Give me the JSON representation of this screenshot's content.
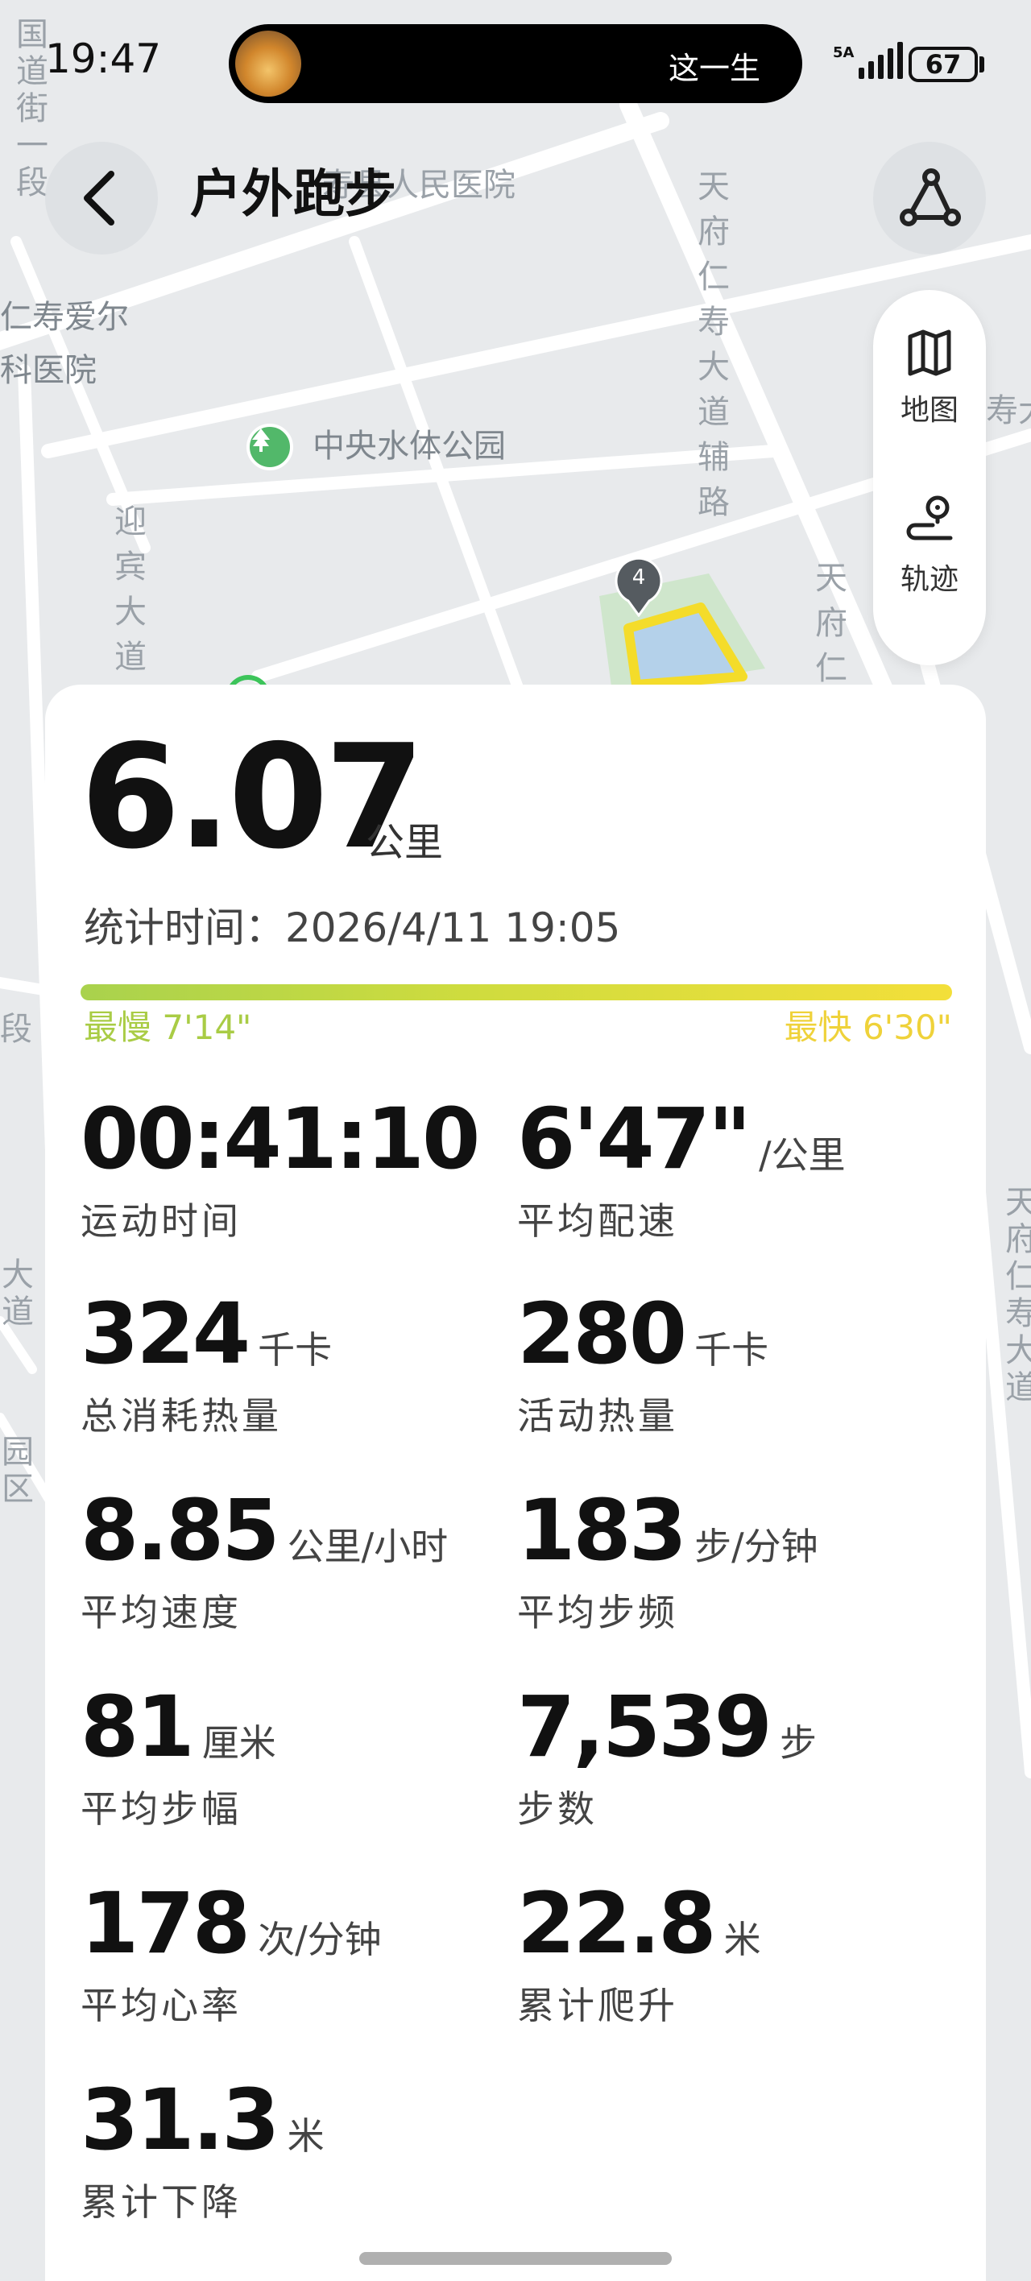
{
  "status_bar": {
    "time": "19:47",
    "music_title": "这一生",
    "network": "5A",
    "battery": "67"
  },
  "header": {
    "title": "户外跑步"
  },
  "map": {
    "labels": {
      "hospital": "寿县人民医院",
      "eye_hospital_1": "仁寿爱尔",
      "eye_hospital_2": "眼科医院",
      "park": "中央水体公园",
      "road_vertical_left": "迎宾大道",
      "road_tianfu_aux": "天府仁寿大道辅路",
      "road_tianfu": "天府仁",
      "road_tianfu_right": "天府仁寿大道",
      "street_top_left": "国道街一段",
      "edge_right": "寿大",
      "edge_left_1": "段",
      "edge_left_2": "大道",
      "edge_left_3": "园区"
    },
    "marker_number": "4"
  },
  "side_panel": {
    "map_label": "地图",
    "track_label": "轨迹"
  },
  "summary": {
    "distance": "6.07",
    "distance_unit": "公里",
    "stat_time": "统计时间：2026/4/11 19:05",
    "pace_slowest": "最慢 7'14\"",
    "pace_fastest": "最快 6'30\""
  },
  "metrics": [
    {
      "value": "00:41:10",
      "unit": "",
      "label": "运动时间"
    },
    {
      "value": "6'47\"",
      "unit": "/公里",
      "label": "平均配速"
    },
    {
      "value": "324",
      "unit": "千卡",
      "label": "总消耗热量"
    },
    {
      "value": "280",
      "unit": "千卡",
      "label": "活动热量"
    },
    {
      "value": "8.85",
      "unit": "公里/小时",
      "label": "平均速度"
    },
    {
      "value": "183",
      "unit": "步/分钟",
      "label": "平均步频"
    },
    {
      "value": "81",
      "unit": "厘米",
      "label": "平均步幅"
    },
    {
      "value": "7,539",
      "unit": "步",
      "label": "步数"
    },
    {
      "value": "178",
      "unit": "次/分钟",
      "label": "平均心率"
    },
    {
      "value": "22.8",
      "unit": "米",
      "label": "累计爬升"
    },
    {
      "value": "31.3",
      "unit": "米",
      "label": "累计下降"
    }
  ]
}
